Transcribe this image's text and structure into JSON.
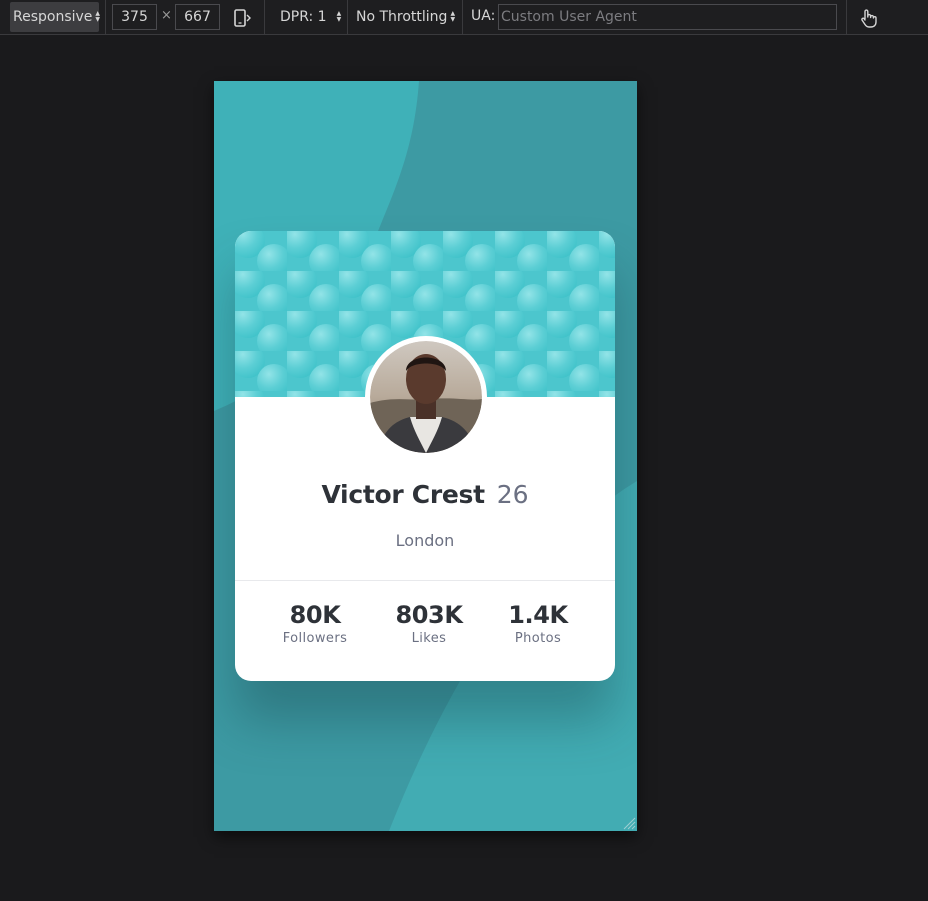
{
  "toolbar": {
    "device_mode": "Responsive",
    "width": "375",
    "times": "×",
    "height": "667",
    "dpr": "DPR: 1",
    "throttling": "No Throttling",
    "ua_label": "UA:",
    "ua_placeholder": "Custom User Agent",
    "icons": [
      "rotate-device-icon",
      "touch-simulation-icon",
      "resize-handle-icon"
    ]
  },
  "profile": {
    "name": "Victor Crest",
    "age": "26",
    "location": "London",
    "stats": [
      {
        "value": "80K",
        "label": "Followers"
      },
      {
        "value": "803K",
        "label": "Likes"
      },
      {
        "value": "1.4K",
        "label": "Photos"
      }
    ]
  },
  "colors": {
    "viewport_bg": "#3d9aa3",
    "card_pattern": "#4fc4cc",
    "text_dark": "#2e3238",
    "text_muted": "#6b7082"
  }
}
